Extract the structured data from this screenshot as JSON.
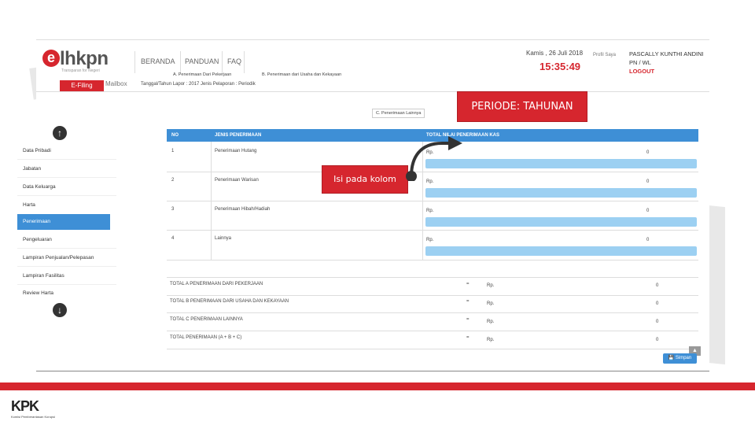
{
  "app": {
    "logo": "elhkpn",
    "tagline": "Transparan for Negeri",
    "nav": [
      "BERANDA",
      "PANDUAN",
      "FAQ"
    ],
    "date": "Kamis , 26 Juli 2018",
    "time": "15:35:49",
    "profile_link": "Profil Saya",
    "user_name": "PASCALLY KUNTHI ANDINI",
    "user_role": "PN / WL",
    "logout": "LOGOUT",
    "efiling": "E-Filing",
    "mailbox": "Mailbox",
    "lapor_info": "Tanggal/Tahun Lapor : 2017   Jenis Pelaporan : Periodik"
  },
  "tabs": [
    "A. Penerimaan Dari Pekerjaan",
    "B. Penerimaan dari Usaha dan Kekayaan",
    "C. Penerimaan Lainnya"
  ],
  "sidebar": {
    "items": [
      "Data Pribadi",
      "Jabatan",
      "Data Keluarga",
      "Harta",
      "Penerimaan",
      "Pengeluaran",
      "Lampiran Penjualan/Pelepasan",
      "Lampiran Fasilitas",
      "Review Harta"
    ],
    "active_index": 4
  },
  "table": {
    "headers": [
      "NO",
      "JENIS PENERIMAAN",
      "TOTAL NILAI PENERIMAAN KAS"
    ],
    "rows": [
      {
        "no": "1",
        "jenis": "Penerimaan Hutang",
        "rp": "Rp.",
        "value": "0"
      },
      {
        "no": "2",
        "jenis": "Penerimaan Warisan",
        "rp": "Rp.",
        "value": "0"
      },
      {
        "no": "3",
        "jenis": "Penerimaan Hibah/Hadiah",
        "rp": "Rp.",
        "value": "0"
      },
      {
        "no": "4",
        "jenis": "Lainnya",
        "rp": "Rp.",
        "value": "0"
      }
    ]
  },
  "totals": [
    {
      "label": "TOTAL A PENERIMAAN DARI PEKERJAAN",
      "eq": "=",
      "rp": "Rp.",
      "value": "0"
    },
    {
      "label": "TOTAL B PENERIMAAN DARI USAHA DAN KEKAYAAN",
      "eq": "=",
      "rp": "Rp.",
      "value": "0"
    },
    {
      "label": "TOTAL C PENERIMAAN LAINNYA",
      "eq": "=",
      "rp": "Rp.",
      "value": "0"
    },
    {
      "label": "TOTAL PENERIMAAN (A + B + C)",
      "eq": "=",
      "rp": "Rp.",
      "value": "0"
    }
  ],
  "simpan": "Simpan",
  "callouts": {
    "periode": "PERIODE: TAHUNAN",
    "isi": "Isi pada kolom"
  },
  "footer": {
    "logo": "KPK",
    "tagline": "Komisi Pemberantasan Korupsi"
  },
  "colors": {
    "brand_red": "#d6262e",
    "accent_blue": "#3e8fd6",
    "input_blue": "#9cd0f2"
  }
}
